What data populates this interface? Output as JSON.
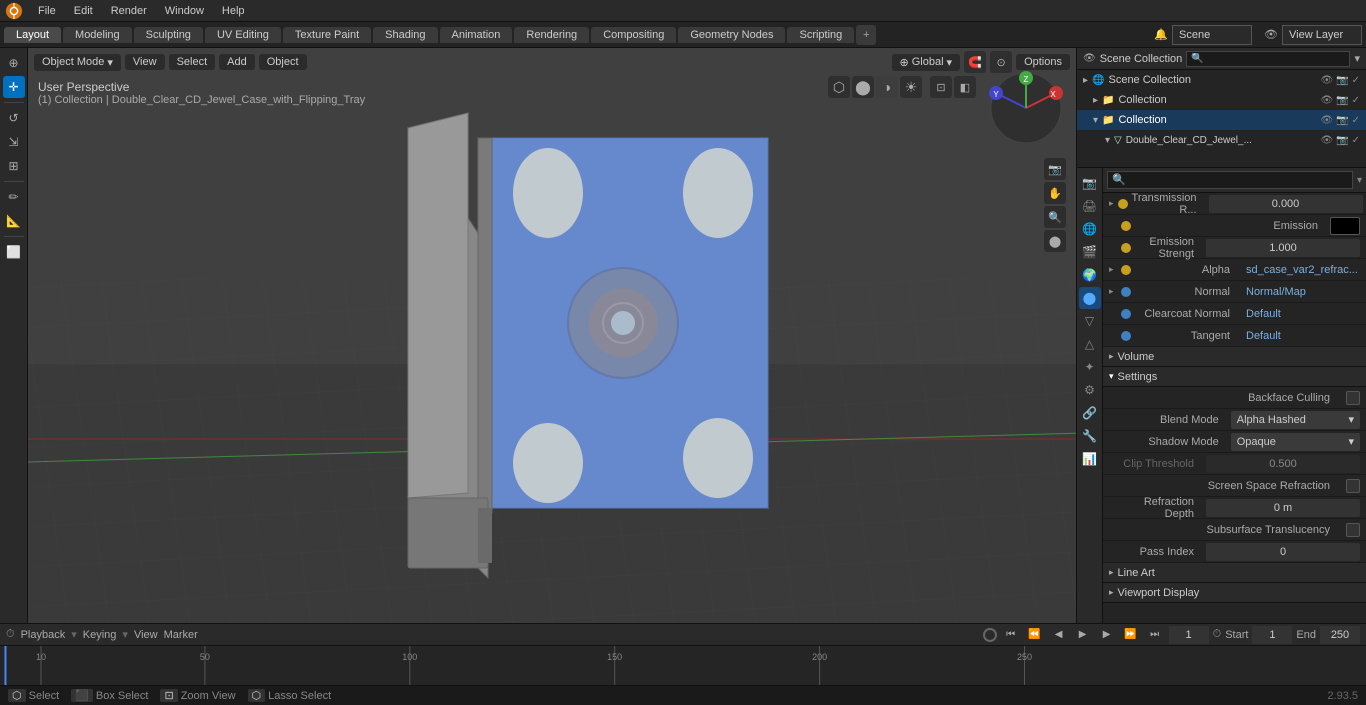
{
  "app": {
    "title": "Blender",
    "version": "2.93.5"
  },
  "top_menu": {
    "logo": "⬡",
    "items": [
      "File",
      "Edit",
      "Render",
      "Window",
      "Help"
    ]
  },
  "workspace_tabs": {
    "tabs": [
      "Layout",
      "Modeling",
      "Sculpting",
      "UV Editing",
      "Texture Paint",
      "Shading",
      "Animation",
      "Rendering",
      "Compositing",
      "Geometry Nodes",
      "Scripting"
    ],
    "active": "Layout",
    "add_label": "+"
  },
  "scene": {
    "name": "Scene",
    "view_layer": "View Layer"
  },
  "viewport": {
    "mode": "Object Mode",
    "view": "View",
    "select": "Select",
    "add": "Add",
    "object": "Object",
    "transform": "Global",
    "perspective": "User Perspective",
    "object_info": "(1) Collection | Double_Clear_CD_Jewel_Case_with_Flipping_Tray",
    "options_label": "Options"
  },
  "outliner": {
    "scene_collection": "Scene Collection",
    "items": [
      {
        "name": "Collection",
        "level": 0,
        "icon": "📁"
      },
      {
        "name": "Collection",
        "level": 1,
        "icon": "📁"
      },
      {
        "name": "Double_Clear_CD_Jewel_...",
        "level": 2,
        "icon": "▽"
      }
    ]
  },
  "properties": {
    "search_placeholder": "🔍",
    "sections": {
      "transmission": {
        "label": "Transmission R...",
        "value": "0.000"
      },
      "emission": {
        "label": "Emission",
        "value": ""
      },
      "emission_strength": {
        "label": "Emission Strengt",
        "value": "1.000"
      },
      "alpha": {
        "label": "Alpha",
        "value": "sd_case_var2_refrac..."
      },
      "normal": {
        "label": "Normal",
        "value": "Normal/Map"
      },
      "clearcoat_normal": {
        "label": "Clearcoat Normal",
        "value": "Default"
      },
      "tangent": {
        "label": "Tangent",
        "value": "Default"
      }
    },
    "volume_label": "Volume",
    "settings_label": "Settings",
    "backface_culling_label": "Backface Culling",
    "blend_mode_label": "Blend Mode",
    "blend_mode_value": "Alpha Hashed",
    "shadow_mode_label": "Shadow Mode",
    "shadow_mode_value": "Opaque",
    "clip_threshold_label": "Clip Threshold",
    "clip_threshold_value": "0.500",
    "screen_space_refraction_label": "Screen Space Refraction",
    "refraction_depth_label": "Refraction Depth",
    "refraction_depth_value": "0 m",
    "subsurface_translucency_label": "Subsurface Translucency",
    "pass_index_label": "Pass Index",
    "pass_index_value": "0",
    "line_art_label": "Line Art",
    "viewport_display_label": "Viewport Display"
  },
  "timeline": {
    "playback_label": "Playback",
    "keying_label": "Keying",
    "view_label": "View",
    "marker_label": "Marker",
    "frame_current": "1",
    "frame_start_label": "Start",
    "frame_start": "1",
    "frame_end_label": "End",
    "frame_end": "250",
    "ruler_marks": [
      "10",
      "50",
      "100",
      "150",
      "200",
      "250"
    ]
  },
  "status_bar": {
    "select_key": "Select",
    "select_label": "",
    "box_select_key": "Box Select",
    "zoom_view_key": "Zoom View",
    "lasso_select_key": "Lasso Select",
    "version": "2.93.5"
  }
}
